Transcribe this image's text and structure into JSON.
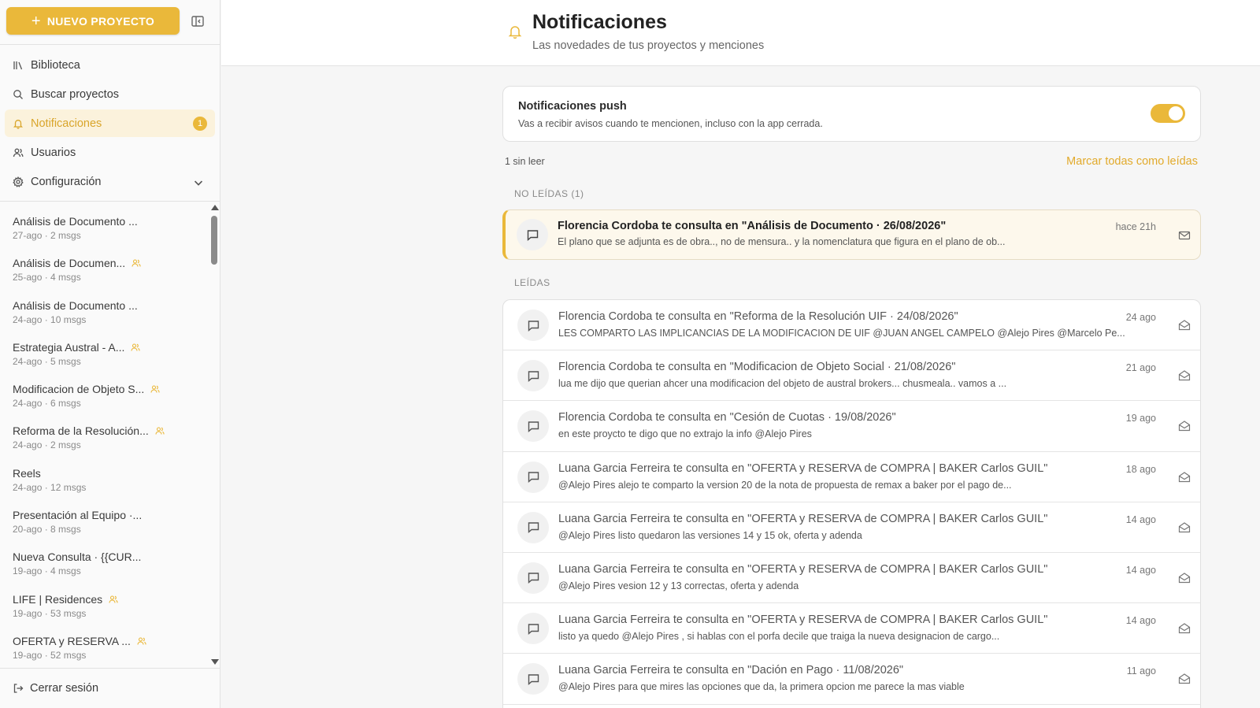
{
  "sidebar": {
    "new_project_label": "NUEVO PROYECTO",
    "nav": [
      {
        "label": "Biblioteca",
        "icon": "library-icon"
      },
      {
        "label": "Buscar proyectos",
        "icon": "search-icon"
      },
      {
        "label": "Notificaciones",
        "icon": "bell-icon",
        "badge": "1",
        "active": true
      },
      {
        "label": "Usuarios",
        "icon": "users-icon"
      },
      {
        "label": "Configuración",
        "icon": "gear-icon"
      }
    ],
    "projects": [
      {
        "title": "Análisis de Documento ...",
        "meta": "27-ago · 2 msgs",
        "shared": false
      },
      {
        "title": "Análisis de Documen...",
        "meta": "25-ago · 4 msgs",
        "shared": true
      },
      {
        "title": "Análisis de Documento ...",
        "meta": "24-ago · 10 msgs",
        "shared": false
      },
      {
        "title": "Estrategia Austral - A...",
        "meta": "24-ago · 5 msgs",
        "shared": true
      },
      {
        "title": "Modificacion de Objeto S...",
        "meta": "24-ago · 6 msgs",
        "shared": true
      },
      {
        "title": "Reforma de la Resolución...",
        "meta": "24-ago · 2 msgs",
        "shared": true
      },
      {
        "title": "Reels",
        "meta": "24-ago · 12 msgs",
        "shared": false
      },
      {
        "title": "Presentación al Equipo ·...",
        "meta": "20-ago · 8 msgs",
        "shared": false
      },
      {
        "title": "Nueva Consulta · {{CUR...",
        "meta": "19-ago · 4 msgs",
        "shared": false
      },
      {
        "title": "LIFE | Residences",
        "meta": "19-ago · 53 msgs",
        "shared": true
      },
      {
        "title": "OFERTA y RESERVA ...",
        "meta": "19-ago · 52 msgs",
        "shared": true
      }
    ],
    "logout_label": "Cerrar sesión"
  },
  "header": {
    "title": "Notificaciones",
    "subtitle": "Las novedades de tus proyectos y menciones"
  },
  "push": {
    "title": "Notificaciones push",
    "description": "Vas a recibir avisos cuando te mencionen, incluso con la app cerrada.",
    "enabled": true
  },
  "summary": {
    "unread_count_label": "1 sin leer",
    "mark_all_label": "Marcar todas como leídas"
  },
  "unread_section_label": "NO LEÍDAS (1)",
  "read_section_label": "LEÍDAS",
  "unread": [
    {
      "title": "Florencia Cordoba te consulta en \"Análisis de Documento · 26/08/2026\"",
      "body": "El plano que se adjunta es de obra.., no de mensura.. y la nomenclatura que figura en el plano de ob...",
      "time": "hace 21h"
    }
  ],
  "read": [
    {
      "title": "Florencia Cordoba te consulta en \"Reforma de la Resolución UIF · 24/08/2026\"",
      "body": "LES COMPARTO LAS IMPLICANCIAS DE LA MODIFICACION DE UIF @JUAN ANGEL CAMPELO @Alejo Pires @Marcelo Pe...",
      "time": "24 ago"
    },
    {
      "title": "Florencia Cordoba te consulta en \"Modificacion de Objeto Social · 21/08/2026\"",
      "body": "lua me dijo que querian ahcer una modificacion del objeto de austral brokers... chusmeala.. vamos a ...",
      "time": "21 ago"
    },
    {
      "title": "Florencia Cordoba te consulta en \"Cesión de Cuotas · 19/08/2026\"",
      "body": "en este proycto te digo que no extrajo la info @Alejo Pires",
      "time": "19 ago"
    },
    {
      "title": "Luana Garcia Ferreira te consulta en \"OFERTA y RESERVA de COMPRA | BAKER Carlos GUIL\"",
      "body": "@Alejo Pires alejo te comparto la version 20 de la nota de propuesta de remax a baker por el pago de...",
      "time": "18 ago"
    },
    {
      "title": "Luana Garcia Ferreira te consulta en \"OFERTA y RESERVA de COMPRA | BAKER Carlos GUIL\"",
      "body": "@Alejo Pires listo quedaron las versiones 14 y 15 ok, oferta y adenda",
      "time": "14 ago"
    },
    {
      "title": "Luana Garcia Ferreira te consulta en \"OFERTA y RESERVA de COMPRA | BAKER Carlos GUIL\"",
      "body": "@Alejo Pires vesion 12 y 13 correctas, oferta y adenda",
      "time": "14 ago"
    },
    {
      "title": "Luana Garcia Ferreira te consulta en \"OFERTA y RESERVA de COMPRA | BAKER Carlos GUIL\"",
      "body": "listo ya quedo @Alejo Pires , si hablas con el porfa decile que traiga la nueva designacion de cargo...",
      "time": "14 ago"
    },
    {
      "title": "Luana Garcia Ferreira te consulta en \"Dación en Pago · 11/08/2026\"",
      "body": "@Alejo Pires para que mires las opciones que da, la primera opcion me parece la mas viable",
      "time": "11 ago"
    }
  ],
  "colors": {
    "accent": "#eab83a",
    "accent_text": "#d9a52a",
    "unread_bg": "#fdf8ec",
    "active_nav_bg": "#fbf2dc"
  }
}
